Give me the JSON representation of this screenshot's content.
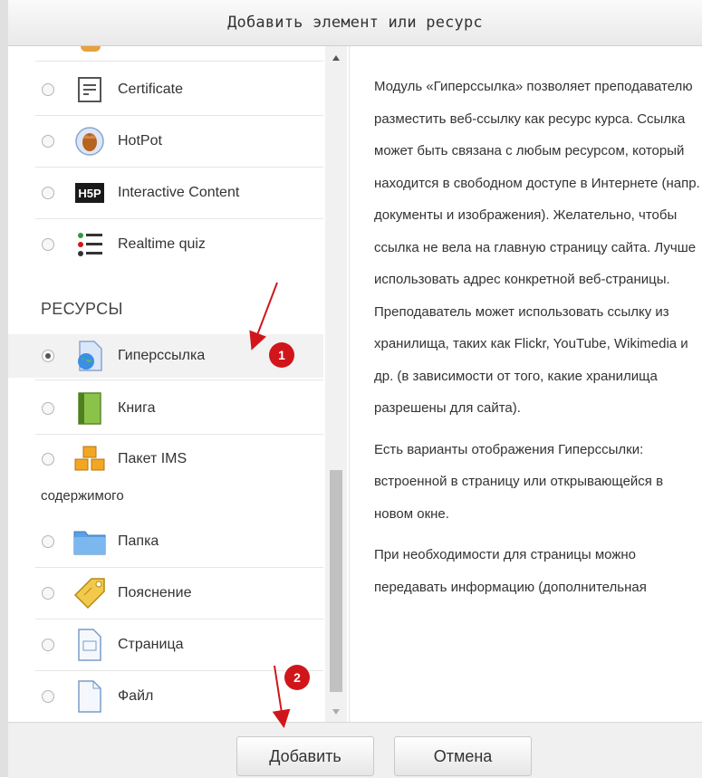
{
  "dialog": {
    "title": "Добавить элемент или ресурс",
    "items_top": [
      {
        "label": "Certificate",
        "icon": "certificate-icon"
      },
      {
        "label": "HotPot",
        "icon": "hotpot-icon"
      },
      {
        "label": "Interactive Content",
        "icon": "h5p-icon"
      },
      {
        "label": "Realtime quiz",
        "icon": "realtime-quiz-icon"
      }
    ],
    "section_resources": "РЕСУРСЫ",
    "items_resources": [
      {
        "label": "Гиперссылка",
        "icon": "url-icon",
        "selected": true
      },
      {
        "label": "Книга",
        "icon": "book-icon"
      },
      {
        "label": "Пакет IMS",
        "label_wrap": "содержимого",
        "icon": "ims-package-icon"
      },
      {
        "label": "Папка",
        "icon": "folder-icon"
      },
      {
        "label": "Пояснение",
        "icon": "label-icon"
      },
      {
        "label": "Страница",
        "icon": "page-icon"
      },
      {
        "label": "Файл",
        "icon": "file-icon"
      }
    ],
    "description": {
      "p1": "Модуль «Гиперссылка» позволяет преподавателю разместить веб-ссылку как ресурс курса. Ссылка может быть связана с любым ресурсом, который находится в свободном доступе в Интернете (напр. документы и изображения). Желательно, чтобы ссылка не вела на главную страницу сайта. Лучше использовать адрес конкретной веб-страницы. Преподаватель может использовать ссылку из хранилища, таких как Flickr, YouTube, Wikimedia и др. (в зависимости от того, какие хранилища разрешены для сайта).",
      "p2": "Есть варианты отображения Гиперссылки: встроенной в страницу или открывающейся в новом окне.",
      "p3": "При необходимости для страницы можно передавать информацию (дополнительная"
    },
    "buttons": {
      "add": "Добавить",
      "cancel": "Отмена"
    },
    "annotations": {
      "badge1": "1",
      "badge2": "2"
    }
  },
  "colors": {
    "badge": "#d0161b",
    "arrow": "#d0161b"
  }
}
